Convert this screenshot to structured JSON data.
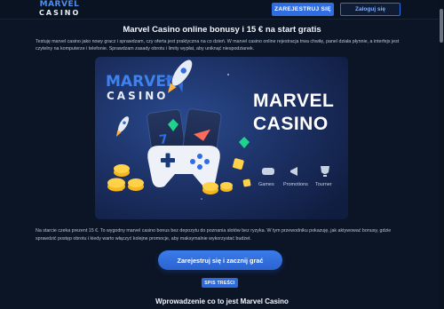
{
  "header": {
    "logo_line1": "MARVEL",
    "logo_line2": "CASINO",
    "register_label": "ZAREJESTRUJ SIĘ",
    "login_label": "Zaloguj się"
  },
  "main": {
    "title": "Marvel Casino online bonusy i 15 € na start gratis",
    "intro": "Testuję marvel casino jako nowy gracz i sprawdzam, czy oferta jest praktyczna na co dzień. W marvel casino online rejestracja trwa chwilę, panel działa płynnie, a interfejs jest czytelny na komputerze i telefonie. Sprawdzam zasady obrotu i limity wypłat, aby uniknąć niespodzianek.",
    "hero": {
      "logo_line1": "MARVEL",
      "logo_line2": "CASINO",
      "title_line1": "MARVEL",
      "title_line2": "CASINO",
      "features": [
        "Games",
        "Promotions",
        "Tourner"
      ]
    },
    "outro": "Na starcie czeka prezent 15 €. To wygodny marvel casino bonus bez depozytu do poznania slotów bez ryzyka. W tym przewodniku pokazuję, jak aktywować bonusy, gdzie sprawdzić postęp obrotu i kiedy warto włączyć kolejne promocje, aby maksymalnie wykorzystać budżet.",
    "cta_label": "Zarejestruj się i zacznij grać",
    "toc_label": "SPIS TREŚCI",
    "section_title": "Wprowadzenie co to jest Marvel Casino"
  },
  "colors": {
    "background": "#0c1526",
    "accent": "#2f6de1",
    "hero_bg": "#1a2d5e"
  }
}
